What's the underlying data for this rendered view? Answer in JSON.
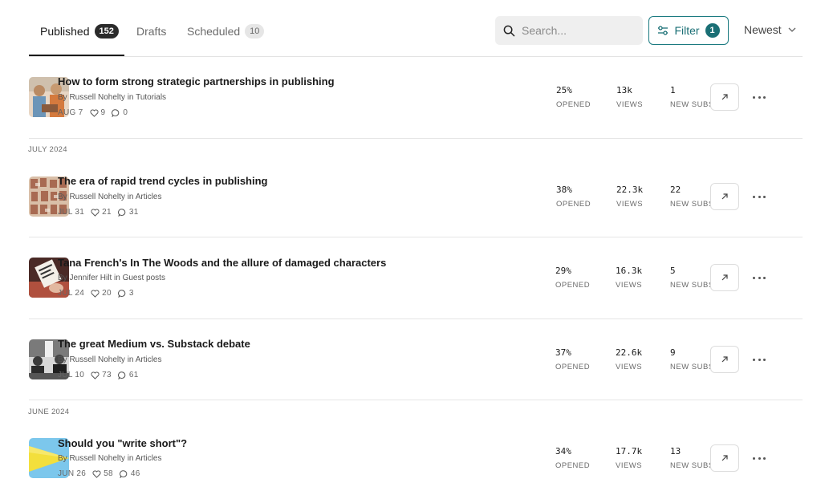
{
  "tabs": [
    {
      "label": "Published",
      "count": "152"
    },
    {
      "label": "Drafts"
    },
    {
      "label": "Scheduled",
      "count": "10"
    }
  ],
  "search": {
    "placeholder": "Search..."
  },
  "filter": {
    "label": "Filter",
    "count": "1"
  },
  "sort": {
    "label": "Newest"
  },
  "groups": [
    "JULY 2024",
    "JUNE 2024"
  ],
  "stat_labels": {
    "opened": "OPENED",
    "views": "VIEWS",
    "subs": "NEW SUBS"
  },
  "posts": [
    {
      "title": "How to form strong strategic partnerships in publishing",
      "byline": "By Russell Nohelty in Tutorials",
      "date": "AUG 7",
      "likes": "9",
      "comments": "0",
      "opened": "25%",
      "views": "13k",
      "subs": "1"
    },
    {
      "title": "The era of rapid trend cycles in publishing",
      "byline": "By Russell Nohelty in Articles",
      "date": "JUL 31",
      "likes": "21",
      "comments": "31",
      "opened": "38%",
      "views": "22.3k",
      "subs": "22"
    },
    {
      "title": "Tana French's In The Woods and the allure of damaged characters",
      "byline": "By Jennifer Hilt in Guest posts",
      "date": "JUL 24",
      "likes": "20",
      "comments": "3",
      "opened": "29%",
      "views": "16.3k",
      "subs": "5"
    },
    {
      "title": "The great Medium vs. Substack debate",
      "byline": "By Russell Nohelty in Articles",
      "date": "JUL 10",
      "likes": "73",
      "comments": "61",
      "opened": "37%",
      "views": "22.6k",
      "subs": "9"
    },
    {
      "title": "Should you \"write short\"?",
      "byline": "By Russell Nohelty in Articles",
      "date": "JUN 26",
      "likes": "58",
      "comments": "46",
      "opened": "34%",
      "views": "17.7k",
      "subs": "13"
    }
  ],
  "colors": {
    "accent": "#1a6f75",
    "text": "#1a1a1a",
    "muted": "#6b6b6b",
    "border": "#e5e5e5"
  }
}
